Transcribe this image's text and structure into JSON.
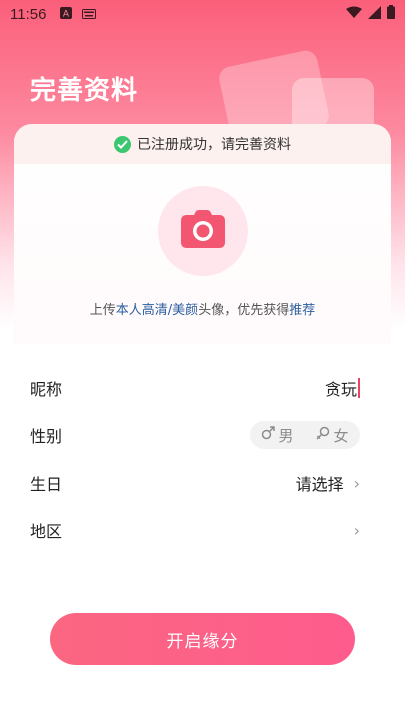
{
  "status_bar": {
    "time": "11:56",
    "icons": [
      "app-a-icon",
      "keyboard-icon",
      "wifi-icon",
      "signal-icon",
      "battery-icon"
    ]
  },
  "header": {
    "title": "完善资料"
  },
  "notice": {
    "text": "已注册成功，请完善资料"
  },
  "avatar": {
    "icon": "camera-icon",
    "hint_prefix": "上传",
    "hint_highlight": "本人高清/美颜",
    "hint_middle": "头像，优先获得",
    "hint_link": "推荐"
  },
  "form": {
    "nickname_label": "昵称",
    "nickname_value": "贪玩",
    "gender_label": "性别",
    "gender_male": "男",
    "gender_female": "女",
    "birthday_label": "生日",
    "birthday_value": "请选择",
    "region_label": "地区",
    "region_value": ""
  },
  "submit": {
    "label": "开启缘分"
  },
  "colors": {
    "accent": "#fb5f7a",
    "button_end": "#fe5c8d",
    "success": "#3cc66f",
    "link": "#2c5e9e"
  }
}
